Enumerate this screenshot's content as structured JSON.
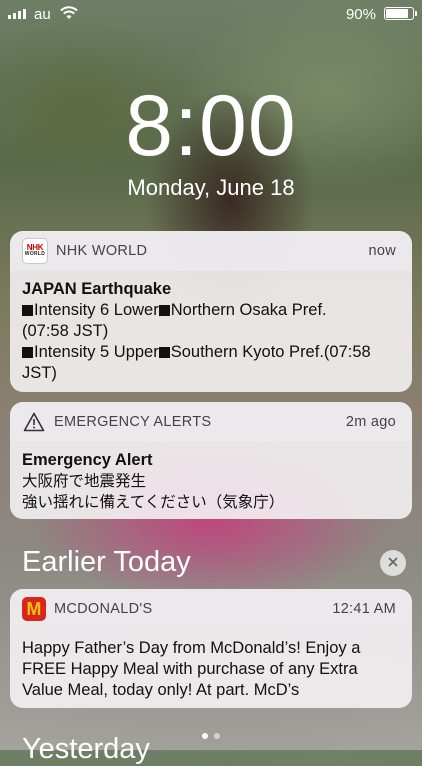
{
  "status_bar": {
    "carrier": "au",
    "battery_percent": "90%",
    "battery_level": 0.9
  },
  "lock": {
    "time": "8:00",
    "date": "Monday, June 18"
  },
  "notifications": [
    {
      "app": "NHK WORLD",
      "icon_text": "NHK",
      "icon_subtext": "WORLD",
      "time": "now",
      "title": "JAPAN Earthquake",
      "lines": [
        "Intensity 6 Lower",
        "Northern Osaka Pref.",
        "(07:58 JST)",
        "Intensity 5 Upper",
        "Southern Kyoto Pref.(07:58 JST)"
      ]
    },
    {
      "app": "EMERGENCY ALERTS",
      "time": "2m ago",
      "title": "Emergency Alert",
      "lines": [
        "大阪府で地震発生",
        "強い揺れに備えてください（気象庁）"
      ]
    }
  ],
  "earlier": {
    "heading": "Earlier Today",
    "notification": {
      "app": "MCDONALD'S",
      "icon_text": "M",
      "time": "12:41 AM",
      "text": "Happy Father’s Day from McDonald’s! Enjoy a FREE Happy Meal with purchase of any Extra Value Meal, today only! At part. McD’s"
    }
  },
  "yesterday_heading": "Yesterday",
  "page_dots": {
    "count": 2,
    "active": 1
  }
}
